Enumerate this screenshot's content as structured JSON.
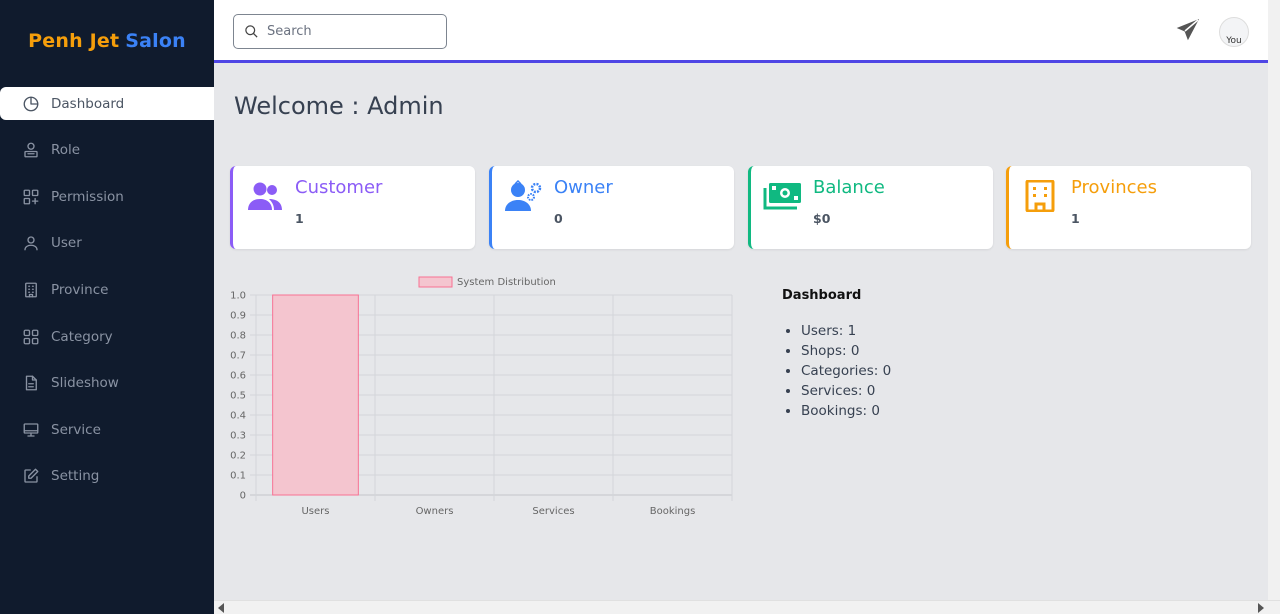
{
  "brand": {
    "part1": "Penh Jet",
    "part2": "Salon"
  },
  "sidebar": {
    "items": [
      {
        "label": "Dashboard",
        "icon": "chart-pie-icon"
      },
      {
        "label": "Role",
        "icon": "user-badge-icon"
      },
      {
        "label": "Permission",
        "icon": "grid-plus-icon"
      },
      {
        "label": "User",
        "icon": "user-icon"
      },
      {
        "label": "Province",
        "icon": "building-icon"
      },
      {
        "label": "Category",
        "icon": "grid-icon"
      },
      {
        "label": "Slideshow",
        "icon": "document-icon"
      },
      {
        "label": "Service",
        "icon": "monitor-icon"
      },
      {
        "label": "Setting",
        "icon": "edit-icon"
      }
    ]
  },
  "search": {
    "placeholder": "Search"
  },
  "header": {
    "avatar_alt": "You"
  },
  "welcome": "Welcome : Admin",
  "cards": [
    {
      "title": "Customer",
      "value": "1",
      "color": "#8b5cf6",
      "icon": "users-icon"
    },
    {
      "title": "Owner",
      "value": "0",
      "color": "#3b82f6",
      "icon": "user-gear-icon"
    },
    {
      "title": "Balance",
      "value": "$0",
      "color": "#10b981",
      "icon": "money-icon"
    },
    {
      "title": "Provinces",
      "value": "1",
      "color": "#f59e0b",
      "icon": "building-icon"
    }
  ],
  "chart_data": {
    "type": "bar",
    "categories": [
      "Users",
      "Owners",
      "Services",
      "Bookings"
    ],
    "series": [
      {
        "name": "System Distribution",
        "values": [
          1,
          0,
          0,
          0
        ]
      }
    ],
    "ylim": [
      0,
      1.0
    ],
    "yticks": [
      "0",
      "0.1",
      "0.2",
      "0.3",
      "0.4",
      "0.5",
      "0.6",
      "0.7",
      "0.8",
      "0.9",
      "1.0"
    ],
    "legend": "top",
    "grid": true,
    "bar_fill": "#f4c5cf",
    "bar_stroke": "#f87193"
  },
  "summary": {
    "title": "Dashboard",
    "items": [
      "Users: 1",
      "Shops: 0",
      "Categories: 0",
      "Services: 0",
      "Bookings: 0"
    ]
  }
}
